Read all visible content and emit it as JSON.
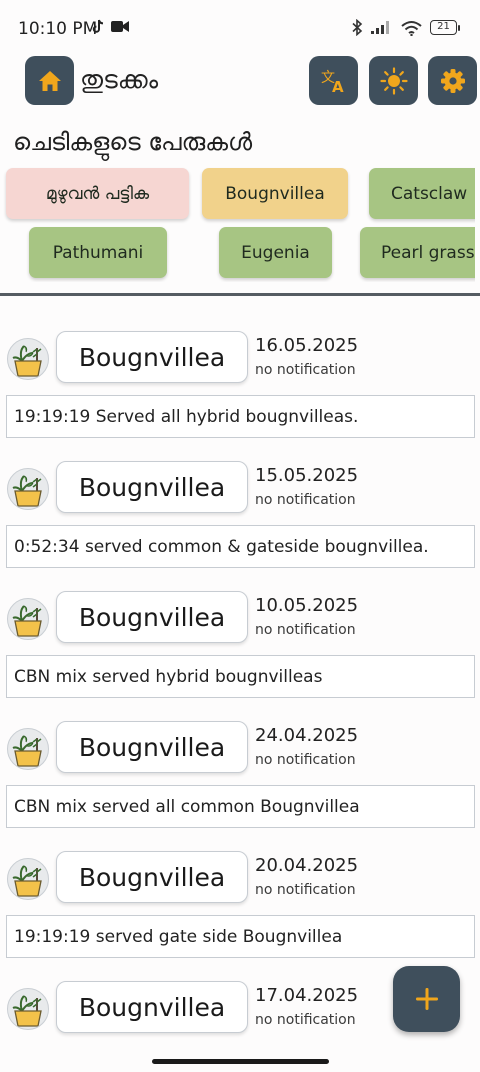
{
  "status_bar": {
    "time": "10:10 PM",
    "battery": "21"
  },
  "header": {
    "title": "തുടക്കം",
    "home_icon": "home-icon",
    "translate_icon": "translate-icon",
    "theme_icon": "sun-icon",
    "settings_icon": "gear-icon",
    "accent_color": "#f0a61c",
    "button_color": "#3f4f5c"
  },
  "plants_section": {
    "title": "ചെടികളുടെ പേരുകൾ",
    "chips": [
      {
        "label": "മുഴുവൻ പട്ടിക",
        "color": "#f6d6d2"
      },
      {
        "label": "Bougnvillea",
        "color": "#f1d28b"
      },
      {
        "label": "Catsclaw",
        "color": "#a7c583"
      },
      {
        "label": "Pathumani",
        "color": "#a7c583"
      },
      {
        "label": "Eugenia",
        "color": "#a7c583"
      },
      {
        "label": "Pearl grass",
        "color": "#a7c583"
      }
    ]
  },
  "log_entries": [
    {
      "plant": "Bougnvillea",
      "date": "16.05.2025",
      "notification": "no notification",
      "note": "19:19:19 Served all hybrid bougnvilleas."
    },
    {
      "plant": "Bougnvillea",
      "date": "15.05.2025",
      "notification": "no notification",
      "note": "0:52:34 served common & gateside bougnvillea."
    },
    {
      "plant": "Bougnvillea",
      "date": "10.05.2025",
      "notification": "no notification",
      "note": "CBN mix served hybrid bougnvilleas"
    },
    {
      "plant": "Bougnvillea",
      "date": "24.04.2025",
      "notification": "no notification",
      "note": "CBN mix served all common Bougnvillea"
    },
    {
      "plant": "Bougnvillea",
      "date": "20.04.2025",
      "notification": "no notification",
      "note": "19:19:19 served gate side Bougnvillea"
    },
    {
      "plant": "Bougnvillea",
      "date": "17.04.2025",
      "notification": "no notification",
      "note": ""
    }
  ],
  "fab": {
    "icon": "plus-icon",
    "symbol": "+"
  }
}
